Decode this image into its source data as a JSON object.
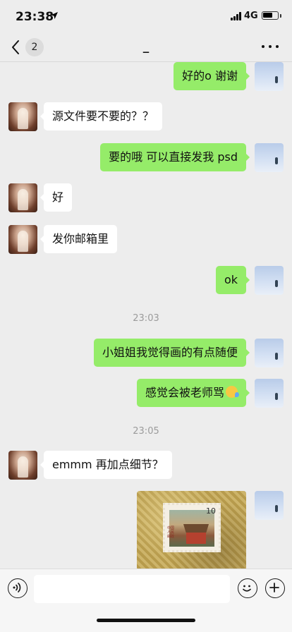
{
  "status_bar": {
    "time": "23:38",
    "network": "4G",
    "battery_level": 0.72
  },
  "nav": {
    "unread_count": "2",
    "title": "_"
  },
  "messages": [
    {
      "side": "right",
      "text": "好的o 谢谢"
    },
    {
      "side": "left",
      "text": "源文件要不要的？？"
    },
    {
      "side": "right",
      "text": "要的哦 可以直接发我 psd"
    },
    {
      "side": "left",
      "text": "好"
    },
    {
      "side": "left",
      "text": "发你邮箱里"
    },
    {
      "side": "right",
      "text": "ok"
    },
    {
      "side": "time",
      "text": "23:03"
    },
    {
      "side": "right",
      "text": "小姐姐我觉得画的有点随便"
    },
    {
      "side": "right",
      "text": "感觉会被老师骂",
      "emoji": "laughing-tears-emoji"
    },
    {
      "side": "time",
      "text": "23:05"
    },
    {
      "side": "left",
      "text": "emmm 再加点细节？"
    },
    {
      "side": "right",
      "type": "image",
      "stamp_value": "10",
      "stamp_text": "中国人民邮政"
    }
  ],
  "input": {
    "value": "",
    "placeholder": ""
  }
}
